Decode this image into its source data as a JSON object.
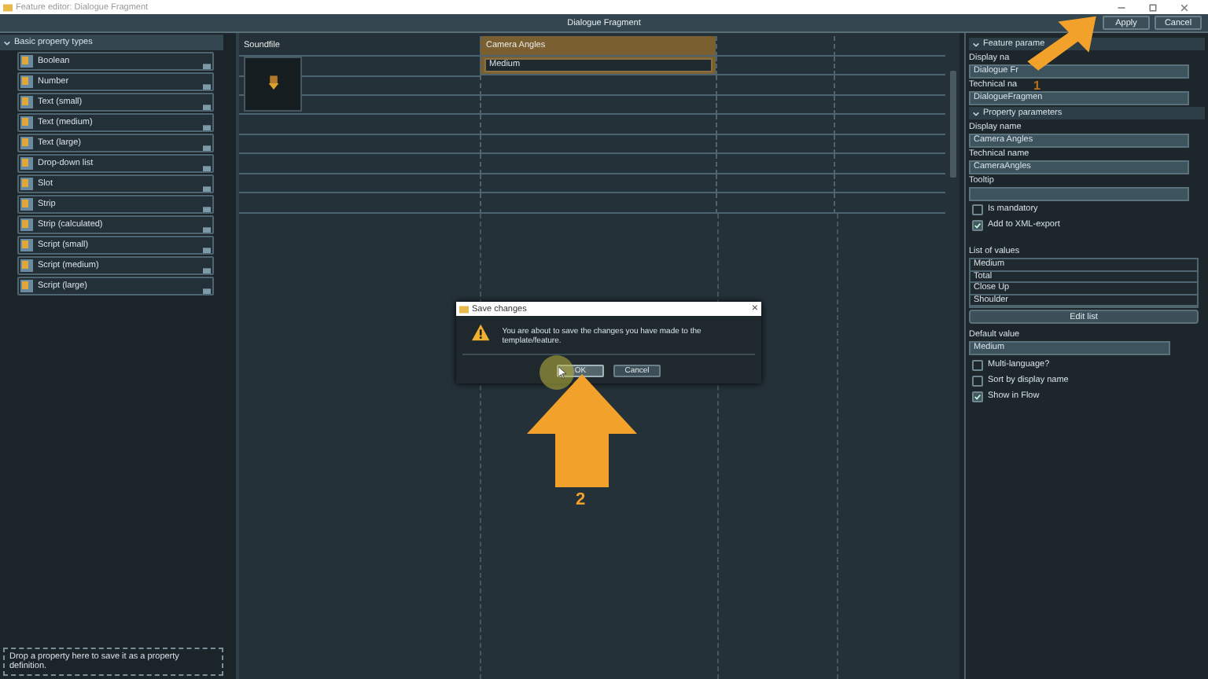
{
  "window": {
    "title": "Feature editor: Dialogue Fragment"
  },
  "toolbar": {
    "title": "Dialogue Fragment",
    "buttons": [
      {
        "label": "Apply"
      },
      {
        "label": "Cancel"
      }
    ]
  },
  "left_panel": {
    "header": "Basic property types",
    "expanded": true,
    "items": [
      {
        "label": "Boolean"
      },
      {
        "label": "Number"
      },
      {
        "label": "Text (small)"
      },
      {
        "label": "Text (medium)"
      },
      {
        "label": "Text (large)"
      },
      {
        "label": "Drop-down list"
      },
      {
        "label": "Slot"
      },
      {
        "label": "Strip"
      },
      {
        "label": "Strip (calculated)"
      },
      {
        "label": "Script (small)"
      },
      {
        "label": "Script (medium)"
      },
      {
        "label": "Script (large)"
      }
    ],
    "footer": "Drop a property here to save it as a property definition."
  },
  "canvas": {
    "columns": [
      {
        "header": "Soundfile",
        "selected": false
      },
      {
        "header": "Camera Angles",
        "selected": true,
        "value": "Medium"
      }
    ]
  },
  "right_panel": {
    "rows": [
      {
        "kind": "header",
        "text": "Feature parame",
        "expanded": true
      },
      {
        "kind": "label",
        "text": "Display na"
      },
      {
        "kind": "field",
        "value": "Dialogue Fr"
      },
      {
        "kind": "label",
        "text": "Technical na"
      },
      {
        "kind": "field",
        "value": "DialogueFragmen"
      },
      {
        "kind": "header",
        "text": "Property parameters",
        "expanded": true
      },
      {
        "kind": "label",
        "text": "Display name"
      },
      {
        "kind": "field",
        "value": "Camera Angles"
      },
      {
        "kind": "label",
        "text": "Technical name"
      },
      {
        "kind": "field",
        "value": "CameraAngles"
      },
      {
        "kind": "label",
        "text": "Tooltip"
      },
      {
        "kind": "field",
        "value": ""
      },
      {
        "kind": "checkbox",
        "text": "Is mandatory",
        "checked": false
      },
      {
        "kind": "checkbox",
        "text": "Add to XML-export",
        "checked": true
      },
      {
        "kind": "gap"
      },
      {
        "kind": "label",
        "text": "List of values"
      },
      {
        "kind": "list",
        "items": [
          "Medium",
          "Total",
          "Close Up",
          "Shoulder"
        ]
      },
      {
        "kind": "button",
        "text": "Edit list"
      },
      {
        "kind": "label",
        "text": "Default value"
      },
      {
        "kind": "dropdown",
        "value": "Medium"
      },
      {
        "kind": "checkbox",
        "text": "Multi-language?",
        "checked": false
      },
      {
        "kind": "checkbox",
        "text": "Sort by display name",
        "checked": false
      },
      {
        "kind": "checkbox",
        "text": "Show in Flow",
        "checked": true
      }
    ]
  },
  "dialog": {
    "title": "Save changes",
    "close": "×",
    "message": "You are about to save the changes you have made to the template/feature.",
    "buttons": [
      {
        "label": "OK",
        "focused": true
      },
      {
        "label": "Cancel",
        "focused": false
      }
    ]
  },
  "annotations": [
    {
      "label": "1"
    },
    {
      "label": "2"
    }
  ]
}
